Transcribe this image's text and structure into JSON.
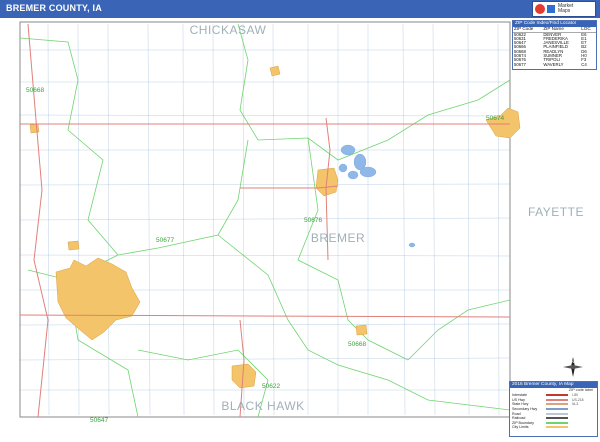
{
  "header": {
    "title": "BREMER COUNTY, IA",
    "logo_text": [
      "Market",
      "Maps"
    ]
  },
  "map": {
    "county_labels": [
      {
        "name": "CHICKASAW"
      },
      {
        "name": "BREMER"
      },
      {
        "name": "FAYETTE"
      },
      {
        "name": "BLACK HAWK"
      }
    ],
    "zip_labels": [
      "50668",
      "50674",
      "50676",
      "50677",
      "50668",
      "50622",
      "50647"
    ],
    "colors": {
      "town_fill": "#f4c46a",
      "town_edge": "#d9a040",
      "road_major": "#e0807a",
      "road_minor": "#7aa0c8",
      "zip_boundary": "#6fd46f",
      "water": "#8fb8e8",
      "county_line": "#c9c9c9"
    }
  },
  "zip_index": {
    "title": "ZIP Code Index/Find Locator",
    "columns": [
      "ZIP Code",
      "ZIP Name",
      "LOC"
    ],
    "rows": [
      [
        "50622",
        "DENVER",
        "E6"
      ],
      [
        "50631",
        "FREDERIKA",
        "E1"
      ],
      [
        "50647",
        "JANESVILLE",
        "E7"
      ],
      [
        "50666",
        "PLAINFIELD",
        "B2"
      ],
      [
        "50668",
        "READLYN",
        "D6"
      ],
      [
        "50674",
        "SUMNER",
        "H0"
      ],
      [
        "50676",
        "TRIPOLI",
        "F3"
      ],
      [
        "50677",
        "WAVERLY",
        "C4"
      ]
    ]
  },
  "legend": {
    "title": "2016 Bremer County, IA Map",
    "subtitle": "ZIP code label",
    "rows": [
      {
        "label": "Interstate",
        "color": "#c0392b",
        "value": "I-80"
      },
      {
        "label": "US Hwy",
        "color": "#e0807a",
        "value": "US-218"
      },
      {
        "label": "State Hwy",
        "color": "#e0a07a",
        "value": "IA-3"
      },
      {
        "label": "Secondary Hwy",
        "color": "#7aa0c8",
        "value": ""
      },
      {
        "label": "Road",
        "color": "#b9c7d6",
        "value": ""
      },
      {
        "label": "Railroad",
        "color": "#555555",
        "value": ""
      },
      {
        "label": "ZIP Boundary",
        "color": "#6fd46f",
        "value": ""
      },
      {
        "label": "City Limits",
        "color": "#f4c46a",
        "value": ""
      }
    ]
  },
  "compass": {
    "label": "N"
  }
}
